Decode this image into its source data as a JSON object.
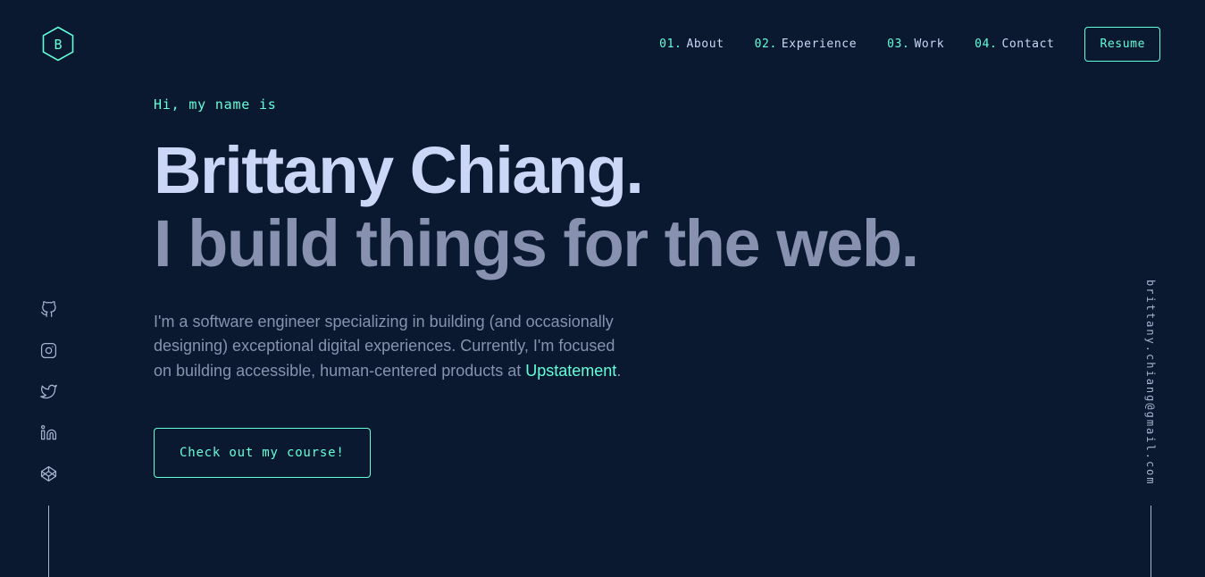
{
  "theme": {
    "background": "#0a192f",
    "accent": "#64ffda",
    "heading": "#ccd6f6",
    "body": "#8892b0",
    "rail": "#a8b2d1"
  },
  "header": {
    "logo_letter": "B",
    "nav": [
      {
        "num": "01.",
        "label": "About"
      },
      {
        "num": "02.",
        "label": "Experience"
      },
      {
        "num": "03.",
        "label": "Work"
      },
      {
        "num": "04.",
        "label": "Contact"
      }
    ],
    "resume_label": "Resume"
  },
  "hero": {
    "greeting": "Hi, my name is",
    "title": "Brittany Chiang.",
    "subtitle": "I build things for the web.",
    "description_part1": "I'm a software engineer specializing in building (and occasionally designing) exceptional digital experiences. Currently, I'm focused on building accessible, human-centered products at ",
    "description_link": "Upstatement",
    "description_part2": ".",
    "cta_label": "Check out my course!"
  },
  "social": [
    {
      "name": "github",
      "label": "GitHub"
    },
    {
      "name": "instagram",
      "label": "Instagram"
    },
    {
      "name": "twitter",
      "label": "Twitter"
    },
    {
      "name": "linkedin",
      "label": "LinkedIn"
    },
    {
      "name": "codepen",
      "label": "CodePen"
    }
  ],
  "email": "brittany.chiang@gmail.com"
}
